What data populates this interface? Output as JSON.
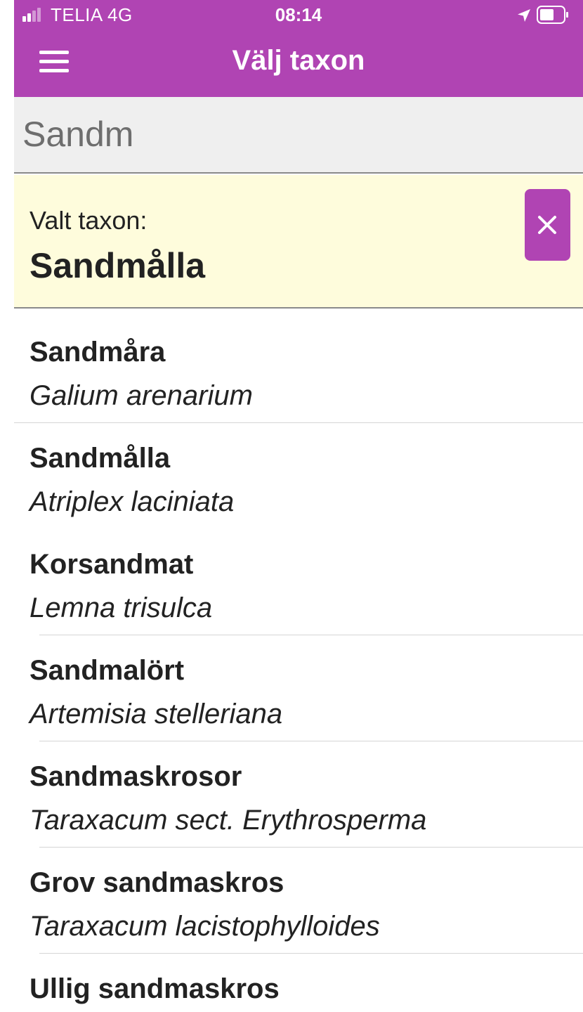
{
  "status_bar": {
    "carrier": "TELIA  4G",
    "time": "08:14"
  },
  "nav": {
    "title": "Välj taxon"
  },
  "search": {
    "value": "Sandm"
  },
  "selected": {
    "label": "Valt taxon:",
    "name": "Sandmålla"
  },
  "results": [
    {
      "common": "Sandmåra",
      "scientific": "Galium arenarium"
    },
    {
      "common": "Sandmålla",
      "scientific": "Atriplex laciniata"
    },
    {
      "common": "Korsandmat",
      "scientific": "Lemna trisulca"
    },
    {
      "common": "Sandmalört",
      "scientific": "Artemisia stelleriana"
    },
    {
      "common": "Sandmaskrosor",
      "scientific": "Taraxacum sect. Erythrosperma"
    },
    {
      "common": "Grov sandmaskros",
      "scientific": "Taraxacum lacistophylloides"
    },
    {
      "common": "Ullig sandmaskros",
      "scientific": ""
    }
  ],
  "icons": {
    "menu": "hamburger-menu-icon",
    "clear": "close-icon",
    "location": "location-arrow-icon",
    "battery": "battery-icon",
    "signal": "signal-strength-icon"
  },
  "colors": {
    "accent": "#b044b3",
    "selected_background": "#fefcdc",
    "search_background": "#efefef"
  }
}
